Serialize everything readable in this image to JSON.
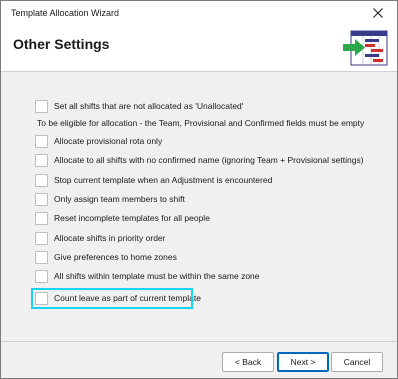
{
  "window": {
    "title": "Template Allocation Wizard"
  },
  "header": {
    "title": "Other Settings"
  },
  "options": [
    {
      "label": "Set all shifts that are not allocated as 'Unallocated'",
      "checked": false
    },
    {
      "label": "Allocate provisional rota only",
      "checked": false
    },
    {
      "label": "Allocate to all shifts with no confirmed name (ignoring Team + Provisional settings)",
      "checked": false
    },
    {
      "label": "Stop current template when an Adjustment is encountered",
      "checked": false
    },
    {
      "label": "Only assign team members to shift",
      "checked": false
    },
    {
      "label": "Reset incomplete templates for all people",
      "checked": false
    },
    {
      "label": "Allocate shifts in priority order",
      "checked": false
    },
    {
      "label": "Give preferences to home zones",
      "checked": false
    },
    {
      "label": "All shifts within template must be within the same zone",
      "checked": false
    },
    {
      "label": "Count leave as part of current template",
      "checked": false
    }
  ],
  "info_text": "To be eligible for allocation - the Team, Provisional and Confirmed fields must be empty",
  "buttons": {
    "back": "< Back",
    "next": "Next >",
    "cancel": "Cancel"
  },
  "colors": {
    "highlight": "#18d4f0",
    "primary_border": "#0067c0"
  }
}
